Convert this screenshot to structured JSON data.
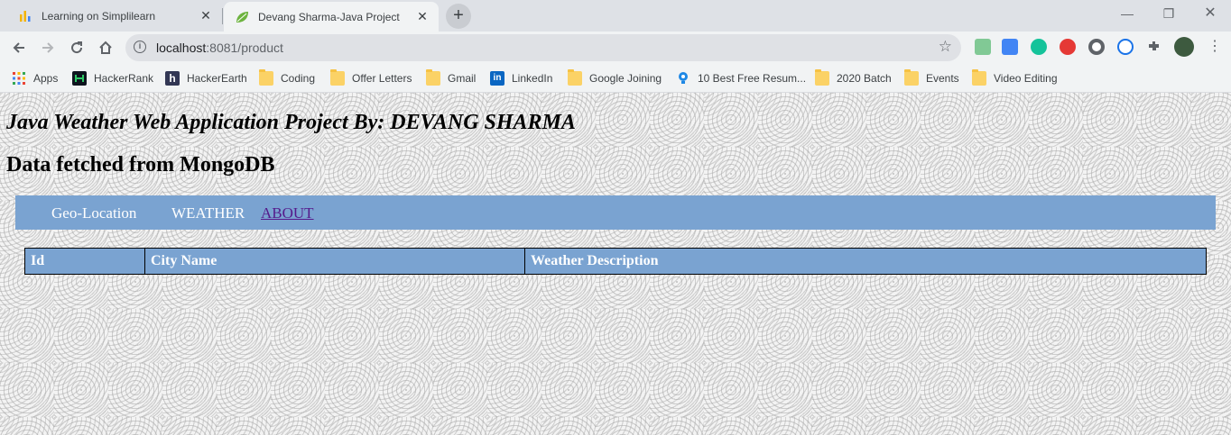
{
  "browser": {
    "tabs": [
      {
        "title": "Learning on Simplilearn",
        "active": false,
        "icon": "simplilearn-icon"
      },
      {
        "title": "Devang Sharma-Java Project",
        "active": true,
        "icon": "spring-leaf-icon"
      }
    ],
    "new_tab_label": "+",
    "url": {
      "host": "localhost",
      "rest": ":8081/product"
    },
    "window_controls": {
      "minimize": "—",
      "maximize": "❐",
      "close": "✕"
    }
  },
  "bookmarks": [
    {
      "label": "Apps",
      "icon": "apps-grid-icon"
    },
    {
      "label": "HackerRank",
      "icon": "hackerrank-icon"
    },
    {
      "label": "HackerEarth",
      "icon": "hackerearth-icon"
    },
    {
      "label": "Coding",
      "icon": "folder-icon"
    },
    {
      "label": "Offer Letters",
      "icon": "folder-icon"
    },
    {
      "label": "Gmail",
      "icon": "folder-icon"
    },
    {
      "label": "LinkedIn",
      "icon": "linkedin-icon"
    },
    {
      "label": "Google Joining",
      "icon": "folder-icon"
    },
    {
      "label": "10 Best Free Resum...",
      "icon": "bulb-icon"
    },
    {
      "label": "2020 Batch",
      "icon": "folder-icon"
    },
    {
      "label": "Events",
      "icon": "folder-icon"
    },
    {
      "label": "Video Editing",
      "icon": "folder-icon"
    }
  ],
  "page": {
    "title": "Java Weather Web Application Project By: DEVANG SHARMA",
    "subtitle": "Data fetched from MongoDB",
    "nav": {
      "geo": "Geo-Location",
      "weather": "WEATHER",
      "about": "ABOUT"
    },
    "table": {
      "headers": [
        "Id",
        "City Name",
        "Weather Description"
      ],
      "rows": []
    }
  },
  "colors": {
    "nav_bg": "#7aa3d1",
    "visited_link": "#551a8b"
  }
}
